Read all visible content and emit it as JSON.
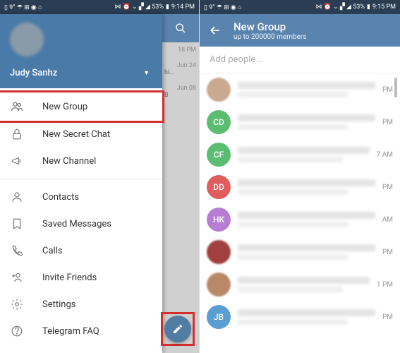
{
  "status": {
    "left_indicators": "▯ 9° ☂ ⊞ ◉ ⌂",
    "right_indicators": "⋈ ⏰ ⌄ ▞ ◢ 53%",
    "time_left": "9:14 PM",
    "time_right": "9:15 PM",
    "battery": "53%"
  },
  "drawer": {
    "user_name": "Judy Sanhz",
    "items": [
      {
        "key": "new-group",
        "label": "New Group",
        "highlighted": true
      },
      {
        "key": "new-secret-chat",
        "label": "New Secret Chat"
      },
      {
        "key": "new-channel",
        "label": "New Channel"
      },
      {
        "key": "contacts",
        "label": "Contacts"
      },
      {
        "key": "saved-messages",
        "label": "Saved Messages"
      },
      {
        "key": "calls",
        "label": "Calls"
      },
      {
        "key": "invite-friends",
        "label": "Invite Friends"
      },
      {
        "key": "settings",
        "label": "Settings"
      },
      {
        "key": "telegram-faq",
        "label": "Telegram FAQ"
      }
    ]
  },
  "chat_stubs": [
    {
      "time": "18 PM"
    },
    {
      "time": "Jun 24",
      "preview": "hi..."
    },
    {
      "time": "Jun 08",
      "preview": "B"
    }
  ],
  "right": {
    "title": "New Group",
    "subtitle": "up to 200000 members",
    "search_placeholder": "Add people..."
  },
  "contacts": [
    {
      "avatar_type": "photo",
      "bg": "#c9a98f",
      "initials": "",
      "time": "PM"
    },
    {
      "avatar_type": "initials",
      "bg": "#5bbd72",
      "initials": "CD",
      "time": "PM"
    },
    {
      "avatar_type": "initials",
      "bg": "#5bbd72",
      "initials": "CF",
      "time": "7 AM"
    },
    {
      "avatar_type": "initials",
      "bg": "#e05d5d",
      "initials": "DD",
      "time": "PM"
    },
    {
      "avatar_type": "initials",
      "bg": "#b77dd4",
      "initials": "HK",
      "time": "AM"
    },
    {
      "avatar_type": "photo",
      "bg": "#a04040",
      "initials": "",
      "time": "PM"
    },
    {
      "avatar_type": "photo",
      "bg": "#b88868",
      "initials": "",
      "time": "1 PM"
    },
    {
      "avatar_type": "initials",
      "bg": "#5a9fd4",
      "initials": "JB",
      "time": "PM"
    }
  ]
}
